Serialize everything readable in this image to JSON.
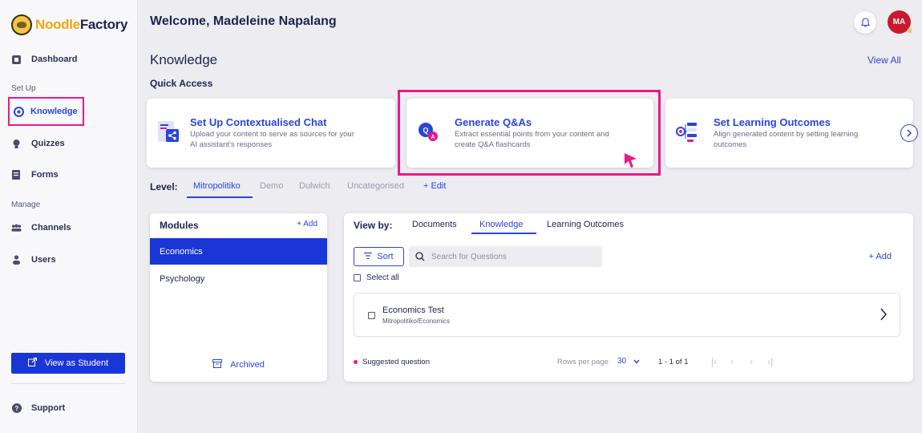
{
  "brand": {
    "part1": "Noodle",
    "part2": "Factory"
  },
  "sidebar": {
    "items": [
      {
        "label": "Dashboard",
        "icon": "dashboard-icon"
      },
      {
        "label": "Knowledge",
        "icon": "knowledge-icon"
      },
      {
        "label": "Quizzes",
        "icon": "lightbulb-icon"
      },
      {
        "label": "Forms",
        "icon": "forms-icon"
      },
      {
        "label": "Channels",
        "icon": "channels-icon"
      },
      {
        "label": "Users",
        "icon": "users-icon"
      }
    ],
    "sections": {
      "setup": "Set Up",
      "manage": "Manage"
    },
    "view_student": "View as Student",
    "support": "Support"
  },
  "header": {
    "welcome": "Welcome, Madeleine Napalang",
    "avatar_initials": "MA"
  },
  "main": {
    "title": "Knowledge",
    "view_all": "View All",
    "quick_access": "Quick Access",
    "cards": [
      {
        "title": "Set Up Contextualised Chat",
        "desc": "Upload your content to serve as sources for your AI assistant's responses"
      },
      {
        "title": "Generate Q&As",
        "desc": "Extract essential points from your content and create Q&A flashcards"
      },
      {
        "title": "Set Learning Outcomes",
        "desc": "Align generated content by setting learning outcomes"
      }
    ],
    "level": {
      "label": "Level:",
      "tabs": [
        "Mitropolitiko",
        "Demo",
        "Dulwich",
        "Uncategorised"
      ],
      "edit": "+ Edit"
    }
  },
  "modules": {
    "title": "Modules",
    "add": "+ Add",
    "items": [
      "Economics",
      "Psychology"
    ],
    "archived": "Archived"
  },
  "questions": {
    "view_by": "View by:",
    "tabs": [
      "Documents",
      "Knowledge",
      "Learning Outcomes"
    ],
    "sort": "Sort",
    "search_placeholder": "Search for Questions",
    "add": "+ Add",
    "select_all": "Select all",
    "rows": [
      {
        "title": "Economics Test",
        "path": "Mitropolitiko/Economics"
      }
    ],
    "suggested": "Suggested question",
    "rows_per_page_label": "Rows per page",
    "rows_per_page": "30",
    "range": "1 - 1 of 1"
  },
  "colors": {
    "accent": "#2a45d8",
    "highlight": "#e8198b",
    "brand_orange": "#f2a516",
    "avatar": "#c8192e"
  }
}
